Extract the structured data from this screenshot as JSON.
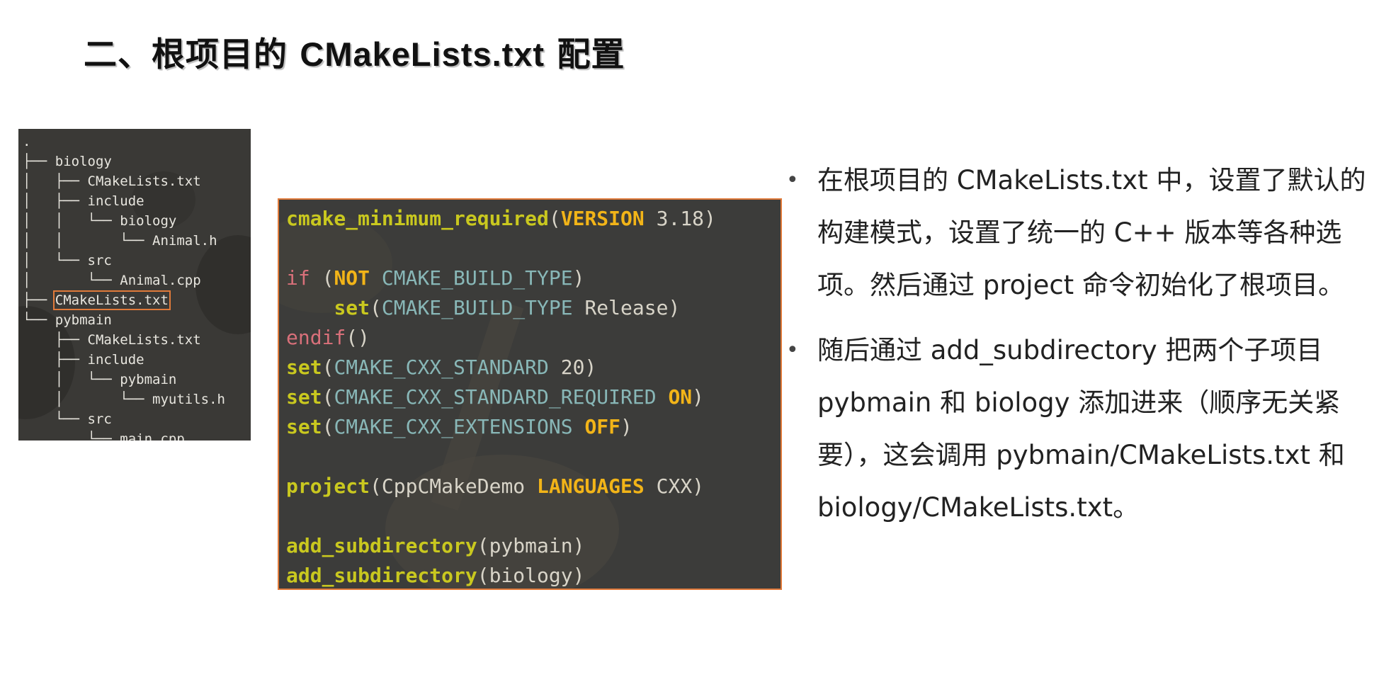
{
  "title": {
    "prefix": "二、根项目的 ",
    "name": "CMakeLists.txt",
    "suffix": " 配置"
  },
  "tree": {
    "root": ".",
    "lines": [
      "├── biology",
      "│   ├── CMakeLists.txt",
      "│   ├── include",
      "│   │   └── biology",
      "│   │       └── Animal.h",
      "│   └── src",
      "│       └── Animal.cpp",
      "├── ",
      "└── pybmain",
      "    ├── CMakeLists.txt",
      "    ├── include",
      "    │   └── pybmain",
      "    │       └── myutils.h",
      "    └── src",
      "        └── main.cpp"
    ],
    "highlighted": "CMakeLists.txt"
  },
  "code": {
    "fn_min": "cmake_minimum_required",
    "kw_version": "VERSION",
    "ver": "3.18",
    "if": "if",
    "kw_not": "NOT",
    "var_build_type": "CMAKE_BUILD_TYPE",
    "fn_set": "set",
    "release": "Release",
    "endif": "endif",
    "var_std": "CMAKE_CXX_STANDARD",
    "std_val": "20",
    "var_std_req": "CMAKE_CXX_STANDARD_REQUIRED",
    "kw_on": "ON",
    "var_ext": "CMAKE_CXX_EXTENSIONS",
    "kw_off": "OFF",
    "fn_project": "project",
    "proj_name": "CppCMakeDemo",
    "kw_languages": "LANGUAGES",
    "lang": "CXX",
    "fn_addsub": "add_subdirectory",
    "sub1": "pybmain",
    "sub2": "biology"
  },
  "bullets": [
    "在根项目的 CMakeLists.txt 中，设置了默认的构建模式，设置了统一的 C++ 版本等各种选项。然后通过 project 命令初始化了根项目。",
    "随后通过 add_subdirectory 把两个子项目 pybmain 和 biology 添加进来（顺序无关紧要），这会调用 pybmain/CMakeLists.txt 和 biology/CMakeLists.txt。"
  ],
  "bullet_symbol": "•"
}
